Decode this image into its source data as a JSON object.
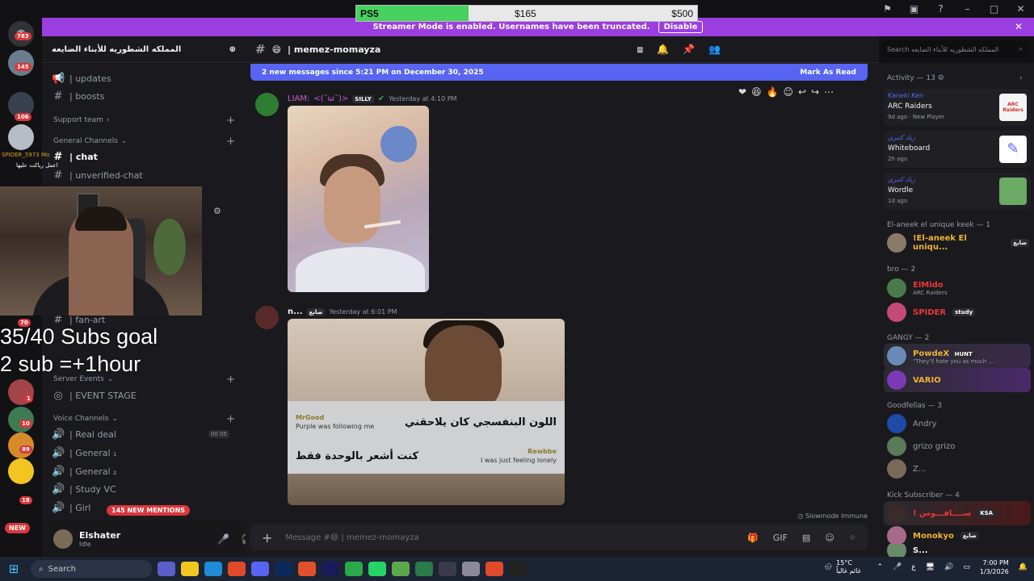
{
  "goal_bar": {
    "label": "PS5",
    "current": "$165",
    "target": "$500",
    "progress": 0.33
  },
  "banner": {
    "text": "Streamer Mode is enabled. Usernames have been truncated.",
    "button": "Disable"
  },
  "server_badges": {
    "home": "783",
    "s1": "145",
    "s2": "106",
    "s3": "70",
    "s4": "1",
    "s5": "10",
    "s6": "89",
    "s7": "18"
  },
  "new_pill": "NEW",
  "server": {
    "name": "المملكه الشطوريه للأبناء الضايعه"
  },
  "channels": {
    "updates": "| updates",
    "boosts": "| boosts",
    "support_cat": "Support team",
    "general_cat": "General Channels",
    "chat": "| chat",
    "unverified": "| unverified-chat",
    "fanart": "| fan-art",
    "events_cat": "Server Events",
    "event_stage": "| EVENT STAGE",
    "voice_cat": "Voice Channels",
    "realdeal": "| Real deal",
    "general1": "| General ₁",
    "general2": "| General ₂",
    "study": "| Study VC",
    "girls": "| Girl",
    "voice_count": [
      "00",
      "05"
    ]
  },
  "overlay_names": [
    "SPIDER_5973",
    "Mo"
  ],
  "overlay_chat": "اعمل رياكت عليها",
  "mentions": "145 NEW MENTIONS",
  "user": {
    "name": "Elshater",
    "status": "Idle"
  },
  "goal_text": {
    "line1": "35/40 Subs goal",
    "line2": "2 sub =+1hour"
  },
  "channel_header": {
    "name": "| memez-momayza"
  },
  "search": {
    "placeholder": "Search المملكه الشطوريه للأبناء الضايعه"
  },
  "new_messages": {
    "text": "2 new messages since 5:21 PM on December 30, 2025",
    "action": "Mark As Read"
  },
  "messages": [
    {
      "author": "LIAM:",
      "kaomoji": "<(ˆωˆ)>",
      "tag": "SILLY",
      "time": "Yesterday at 4:10 PM"
    },
    {
      "author": "n...",
      "tag": "ضايع",
      "time": "Yesterday at 6:01 PM",
      "meme": {
        "user1": "MrGood",
        "ar1": "اللون البنفسجي كان يلاحقني",
        "en1": "Purple was following me",
        "user2": "Rewbbe",
        "ar2": "كنت أشعر بالوحدة فقط",
        "en2": "I was just feeling lonely"
      }
    }
  ],
  "slowmode": "Slowmode Immune",
  "composer": {
    "placeholder": "Message #😄 | memez-momayza"
  },
  "activity": {
    "title": "Activity — 13",
    "items": [
      {
        "name": "Kaneki Ken",
        "title": "ARC Raiders",
        "sub": "9d ago",
        "extra": "New Player",
        "thumb_text": "ARC Raiders"
      },
      {
        "name": "زياد كتبري",
        "title": "Whiteboard",
        "sub": "2h ago"
      },
      {
        "name": "زياد كتبري",
        "title": "Wordle",
        "sub": "1d ago"
      }
    ]
  },
  "members": {
    "sec1": "El-aneek el unique keek — 1",
    "m1": "!El-aneek El uniqu...",
    "m1tag": "ضايع",
    "sec2": "bro — 2",
    "m2": "ElMido",
    "m2sub": "ARC Raiders",
    "m3": "SPIDER",
    "m3tag": "study",
    "sec3": "GANGY — 2",
    "m4": "PowdeX",
    "m4tag": "HUNT",
    "m4sub": "\"They'll hate you as much ...",
    "m5": "VARIO",
    "sec4": "Goodfellas — 3",
    "m6": "Andry",
    "m7": "grizo grizo",
    "m8": "Z...",
    "sec5": "Kick Subscriber — 4",
    "m9": "! ســــافـــوس",
    "m9tag": "KSA",
    "m10": "Monokyo",
    "m10tag": "ضايع",
    "m11": "S..."
  },
  "taskbar": {
    "search": "Search",
    "temp": "15°C",
    "weather": "غائم غالباً",
    "time": "7:00 PM",
    "date": "1/3/2026",
    "lang": "ع"
  },
  "colors": {
    "accent": "#5865f2",
    "banner": "#9b3ee0",
    "danger": "#da373c",
    "progress": "#46d160"
  }
}
